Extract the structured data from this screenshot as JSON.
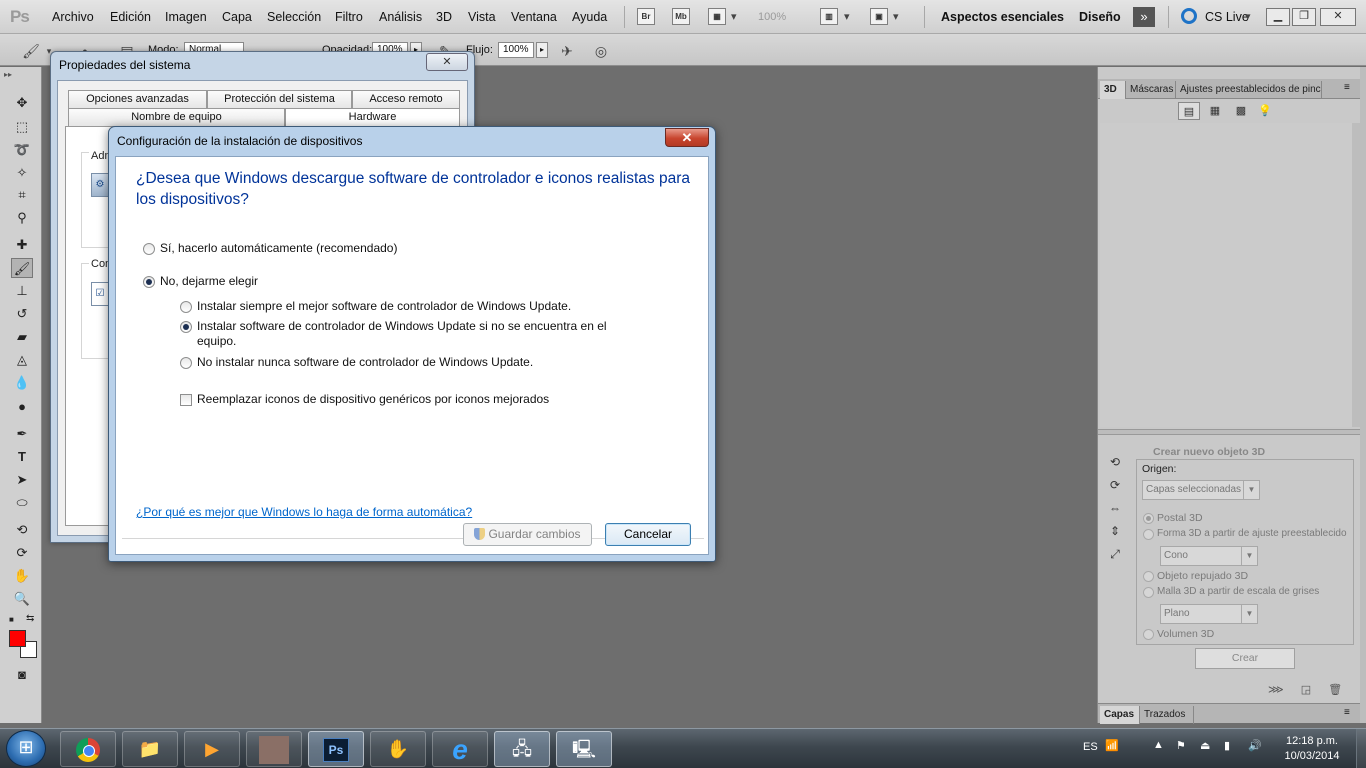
{
  "photoshop": {
    "logo": "Ps",
    "menu": [
      "Archivo",
      "Edición",
      "Imagen",
      "Capa",
      "Selección",
      "Filtro",
      "Análisis",
      "3D",
      "Vista",
      "Ventana",
      "Ayuda"
    ],
    "bridge_btn": "Br",
    "minibridge_btn": "Mb",
    "zoom": "100%",
    "workspace_essentials": "Aspectos esenciales",
    "workspace_design": "Diseño",
    "cs_live": "CS Live",
    "options": {
      "mode_label": "Modo:",
      "mode_value": "Normal",
      "opacity_label": "Opacidad:",
      "opacity_value": "100%",
      "flow_label": "Flujo:",
      "flow_value": "100%"
    },
    "foreground_color": "#ff0000",
    "background_color": "#ffffff"
  },
  "right_panel": {
    "tabs": [
      "3D",
      "Máscaras",
      "Ajustes preestablecidos de pincel"
    ],
    "create_title": "Crear nuevo objeto 3D",
    "origin_label": "Origen:",
    "origin_value": "Capas seleccionadas",
    "options": {
      "postcard": "Postal 3D",
      "preset_shape": "Forma 3D a partir de ajuste preestablecido",
      "shape_value": "Cono",
      "repousse": "Objeto repujado 3D",
      "grayscale_mesh": "Malla 3D a partir de escala de grises",
      "mesh_value": "Plano",
      "volume": "Volumen 3D"
    },
    "create_button": "Crear",
    "bottom_tabs": [
      "Capas",
      "Trazados"
    ]
  },
  "system_properties": {
    "title": "Propiedades del sistema",
    "tabs_row1": [
      "Opciones avanzadas",
      "Protección del sistema",
      "Acceso remoto"
    ],
    "tabs_row2": [
      "Nombre de equipo",
      "Hardware"
    ],
    "group1_label": "Adm",
    "group2_label": "Conf"
  },
  "dialog": {
    "title": "Configuración de la instalación de dispositivos",
    "heading": "¿Desea que Windows descargue software de controlador e iconos realistas para los dispositivos?",
    "option_auto": "Sí, hacerlo automáticamente (recomendado)",
    "option_choose": "No, dejarme elegir",
    "sub_always": "Instalar siempre el mejor software de controlador de Windows Update.",
    "sub_if_not_found": "Instalar software de controlador de Windows Update si no se encuentra en el equipo.",
    "sub_never": "No instalar nunca software de controlador de Windows Update.",
    "replace_icons": "Reemplazar iconos de dispositivo genéricos por iconos mejorados",
    "link": "¿Por qué es mejor que Windows lo haga de forma automática?",
    "save_button": "Guardar cambios",
    "cancel_button": "Cancelar"
  },
  "taskbar": {
    "language": "ES",
    "time": "12:18 p.m.",
    "date": "10/03/2014"
  }
}
